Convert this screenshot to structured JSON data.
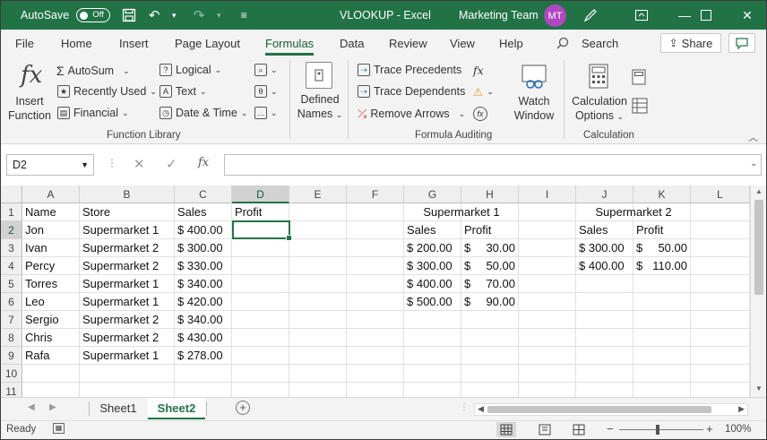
{
  "titlebar": {
    "autosave_label": "AutoSave",
    "autosave_state": "Off",
    "file_title": "VLOOKUP",
    "app_name": "Excel",
    "team": "Marketing Team",
    "avatar_initials": "MT",
    "accent_color": "#217346"
  },
  "menu": {
    "tabs": [
      "File",
      "Home",
      "Insert",
      "Page Layout",
      "Formulas",
      "Data",
      "Review",
      "View",
      "Help"
    ],
    "active_tab": "Formulas",
    "search_label": "Search",
    "share_label": "Share"
  },
  "ribbon": {
    "insert_function": [
      "Insert",
      "Function"
    ],
    "autosum": "AutoSum",
    "recently_used": "Recently Used",
    "financial": "Financial",
    "logical": "Logical",
    "text": "Text",
    "date_time": "Date & Time",
    "defined_names": [
      "Defined",
      "Names"
    ],
    "trace_precedents": "Trace Precedents",
    "trace_dependents": "Trace Dependents",
    "remove_arrows": "Remove Arrows",
    "watch_window": [
      "Watch",
      "Window"
    ],
    "calculation_options": [
      "Calculation",
      "Options"
    ],
    "group_function_library": "Function Library",
    "group_formula_auditing": "Formula Auditing",
    "group_calculation": "Calculation"
  },
  "formula_bar": {
    "name_box": "D2",
    "fx": "fx",
    "formula": ""
  },
  "grid": {
    "columns": [
      "A",
      "B",
      "C",
      "D",
      "E",
      "F",
      "G",
      "H",
      "I",
      "J",
      "K",
      "L"
    ],
    "selected_column": "D",
    "rows": [
      "1",
      "2",
      "3",
      "4",
      "5",
      "6",
      "7",
      "8",
      "9",
      "10",
      "11"
    ],
    "selected_row": "2",
    "main_headers": [
      "Name",
      "Store",
      "Sales",
      "Profit"
    ],
    "main_rows": [
      [
        "Jon",
        "Supermarket 1",
        "$ 400.00"
      ],
      [
        "Ivan",
        "Supermarket 2",
        "$ 300.00"
      ],
      [
        "Percy",
        "Supermarket 2",
        "$ 330.00"
      ],
      [
        "Torres",
        "Supermarket 1",
        "$ 340.00"
      ],
      [
        "Leo",
        "Supermarket 1",
        "$ 420.00"
      ],
      [
        "Sergio",
        "Supermarket 2",
        "$ 340.00"
      ],
      [
        "Chris",
        "Supermarket 2",
        "$ 430.00"
      ],
      [
        "Rafa",
        "Supermarket 1",
        "$ 278.00"
      ]
    ],
    "sm1": {
      "title": "Supermarket 1",
      "headers": [
        "Sales",
        "Profit"
      ],
      "rows": [
        [
          "$ 200.00",
          "$",
          "30.00"
        ],
        [
          "$ 300.00",
          "$",
          "50.00"
        ],
        [
          "$ 400.00",
          "$",
          "70.00"
        ],
        [
          "$ 500.00",
          "$",
          "90.00"
        ]
      ]
    },
    "sm2": {
      "title": "Supermarket 2",
      "headers": [
        "Sales",
        "Profit"
      ],
      "rows": [
        [
          "$ 300.00",
          "$",
          "50.00"
        ],
        [
          "$ 400.00",
          "$",
          "110.00"
        ]
      ]
    }
  },
  "sheets": {
    "tabs": [
      "Sheet1",
      "Sheet2"
    ],
    "active": "Sheet2"
  },
  "status": {
    "ready": "Ready",
    "zoom": "100%"
  }
}
